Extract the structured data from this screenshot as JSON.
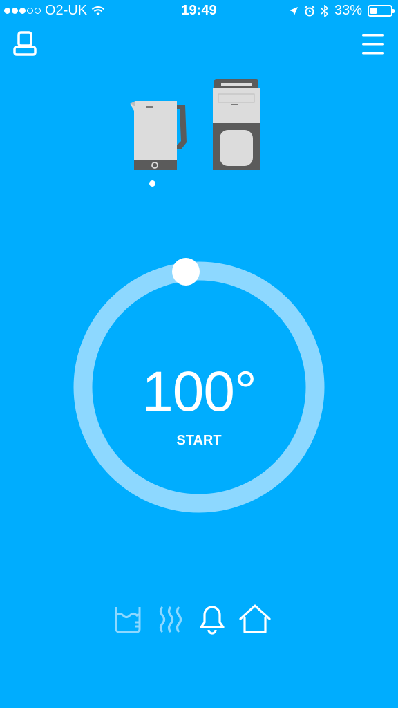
{
  "status_bar": {
    "carrier": "O2-UK",
    "signal_bars_filled": 3,
    "signal_bars_total": 5,
    "time": "19:49",
    "battery": "33%",
    "battery_level": 0.33
  },
  "header": {
    "left_icon": "device-icon",
    "right_icon": "hamburger-menu-icon"
  },
  "appliances": {
    "items": [
      "kettle",
      "coffee-machine"
    ],
    "selected_index": 0
  },
  "dial": {
    "temperature": "100°",
    "action_label": "START",
    "colors": {
      "ring": "#8dd8ff",
      "handle": "#ffffff",
      "background": "#00adfe"
    }
  },
  "bottom_nav": {
    "items": [
      {
        "icon": "water-level-icon",
        "active": false
      },
      {
        "icon": "heat-waves-icon",
        "active": false
      },
      {
        "icon": "bell-icon",
        "active": true
      },
      {
        "icon": "home-icon",
        "active": true
      }
    ]
  }
}
